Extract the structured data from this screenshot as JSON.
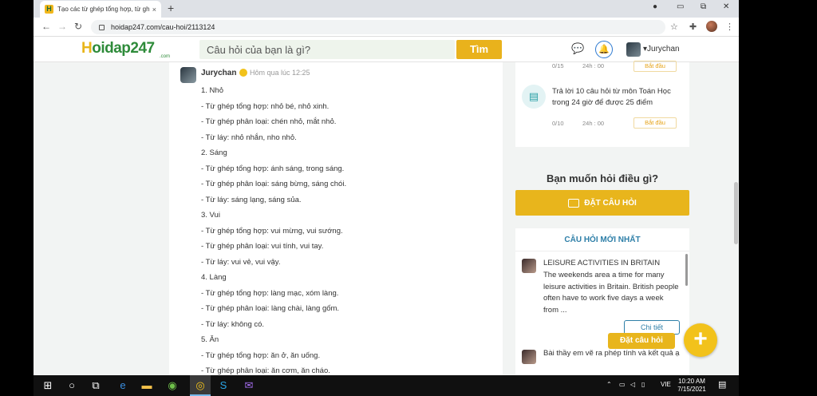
{
  "browser": {
    "tab_title": "Tạo các từ ghép tổng hợp, từ ghé",
    "tab_close": "×",
    "new_tab": "+",
    "url": "hoidap247.com/cau-hoi/2113124",
    "window_controls": [
      "●",
      "▭",
      "⧉",
      "✕"
    ]
  },
  "site": {
    "logo_prefix": "H",
    "logo_rest": "oidap247",
    "logo_sub": ".com",
    "search_placeholder": "Câu hỏi của bạn là gì?",
    "search_button": "Tìm",
    "user": "Jurychan",
    "user_caret": "▾"
  },
  "answer": {
    "author": "Jurychan",
    "time": "Hôm qua lúc 12:25",
    "lines": [
      "1. Nhỏ",
      "- Từ ghép tổng hợp: nhỏ bé, nhỏ xinh.",
      "- Từ ghép phân loại: chén nhỏ, mắt nhỏ.",
      "- Từ láy: nhỏ nhắn, nho nhỏ.",
      "2. Sáng",
      "- Từ ghép tổng hợp: ánh sáng, trong sáng.",
      "- Từ ghép phân loại: sáng bừng, sáng chói.",
      "- Từ láy: sáng lạng, sáng sủa.",
      "3. Vui",
      "- Từ ghép tổng hợp: vui mừng, vui sướng.",
      "- Từ ghép phân loại: vui tính, vui tay.",
      "- Từ láy: vui vẻ, vui vậy.",
      "4. Làng",
      "- Từ ghép tổng hợp: làng mạc, xóm làng.",
      "- Từ ghép phân loại: làng chài, làng gốm.",
      "- Từ láy: không có.",
      "5. Ăn",
      "- Từ ghép tổng hợp: ăn ở, ăn uống.",
      "- Từ ghép phân loại: ăn cơm, ăn cháo."
    ]
  },
  "tasks": {
    "task1_count": "0/15",
    "task1_time": "24h : 00",
    "task1_button": "Bắt đầu",
    "task2_text": "Trả lời 10 câu hỏi  từ môn Toán Học trong 24 giờ để được 25 điểm",
    "task2_count": "0/10",
    "task2_time": "24h : 00",
    "task2_button": "Bắt đầu"
  },
  "ask": {
    "title": "Bạn muốn hỏi điều gì?",
    "button": "ĐẶT CÂU HỎI"
  },
  "new_questions": {
    "title": "CÂU HỎI MỚI NHẤT",
    "q1_title": "LEISURE ACTIVITIES IN BRITAIN",
    "q1_body": "The weekends area a time for many leisure activities in Britain. British people often have to work five days a week from ...",
    "detail_button": "Chi tiết",
    "q2_body": "Bài thầy em vẽ ra phép tính và kết quả ạ"
  },
  "fab": {
    "label": "Đặt câu hỏi",
    "symbol": "+"
  },
  "taskbar": {
    "lang": "VIE",
    "time": "10:20 AM",
    "date": "7/15/2021"
  },
  "colors": {
    "brand_yellow": "#e8b51c",
    "brand_green": "#2e8b3a",
    "link_blue": "#2e7fa8"
  }
}
